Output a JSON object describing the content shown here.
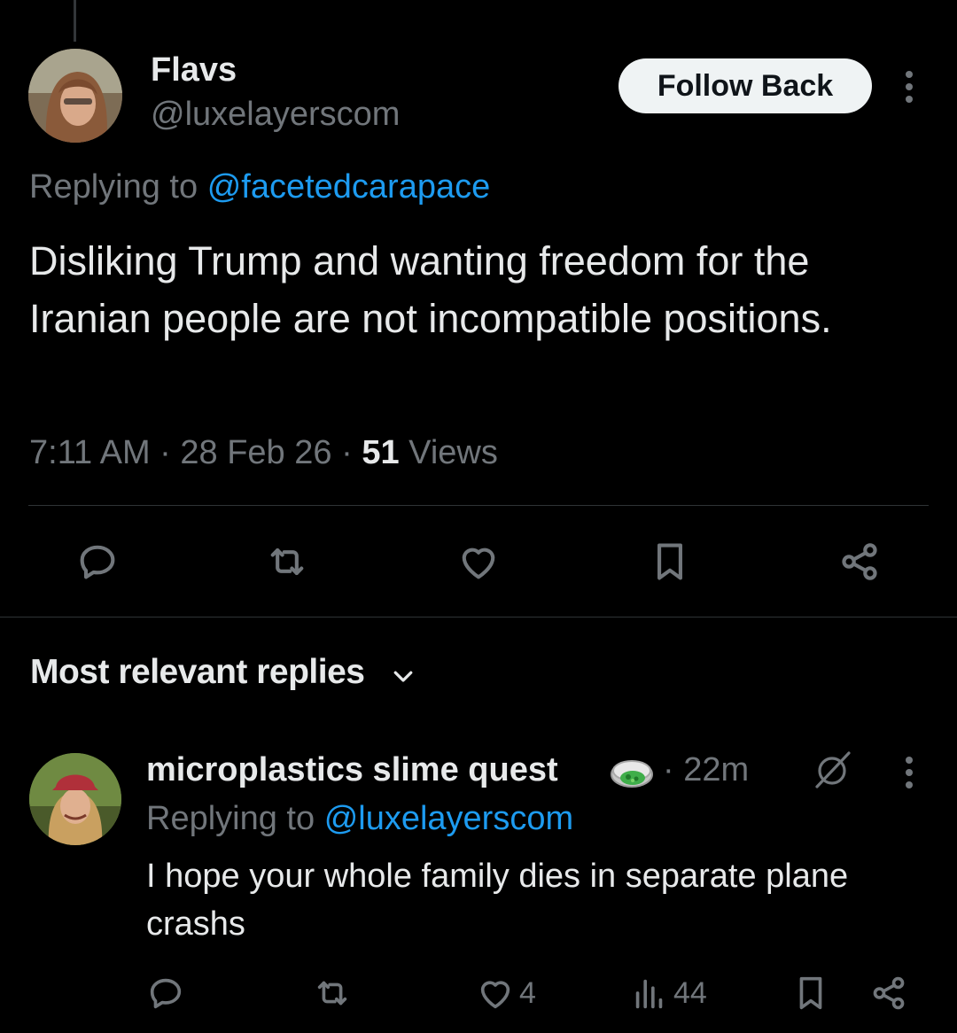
{
  "tweet": {
    "display_name": "Flavs",
    "handle": "@luxelayerscom",
    "follow_label": "Follow Back",
    "replying_prefix": "Replying to",
    "replying_handle": "@facetedcarapace",
    "text": "Disliking Trump and wanting freedom for the Iranian people are not incompatible positions.",
    "time": "7:11 AM",
    "sep1": "·",
    "date": "28 Feb 26",
    "sep2": "·",
    "views_count": "51",
    "views_label": "Views"
  },
  "actions": [
    "reply-icon",
    "retweet-icon",
    "like-icon",
    "bookmark-icon",
    "share-icon"
  ],
  "replies_section": {
    "title": "Most relevant replies"
  },
  "reply": {
    "display_name": "microplastics slime quest",
    "sep": "·",
    "time": "22m",
    "replying_prefix": "Replying to",
    "replying_handle": "@luxelayerscom",
    "text": "I hope your whole family dies in separate plane crashs",
    "likes": "4",
    "views": "44"
  },
  "colors": {
    "background": "#000000",
    "text": "#e7e9ea",
    "secondary": "#71767b",
    "link": "#1d9bf0",
    "divider": "#2f3336"
  }
}
